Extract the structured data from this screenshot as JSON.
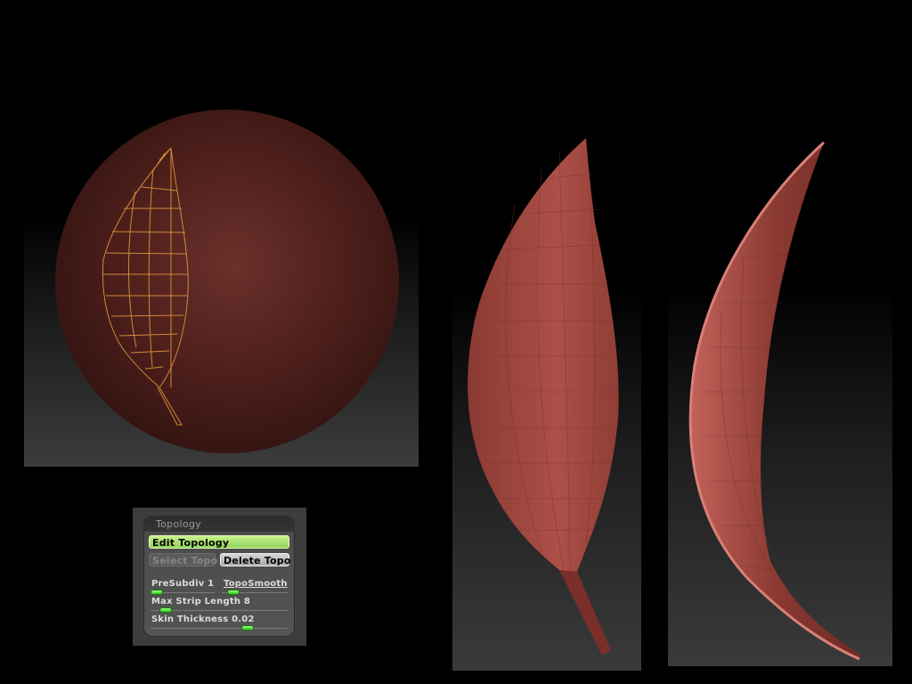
{
  "panel": {
    "title": "Topology",
    "edit_topology": "Edit Topology",
    "select_topo": "Select Topo",
    "delete_topo": "Delete Topo",
    "presubdiv": {
      "label": "PreSubdiv",
      "value": "1",
      "level": 0.1
    },
    "toposmooth": {
      "label": "TopoSmooth",
      "level": 0.1
    },
    "max_strip_length": {
      "label": "Max Strip Length",
      "value": "8",
      "level": 0.08
    },
    "skin_thickness": {
      "label": "Skin Thickness",
      "value": "0.02",
      "level": 0.7
    }
  },
  "colors": {
    "clay": "#6e2a24",
    "leaf": "#a8443a",
    "wire": "#e08a2a",
    "button_active": "#a4e070"
  }
}
